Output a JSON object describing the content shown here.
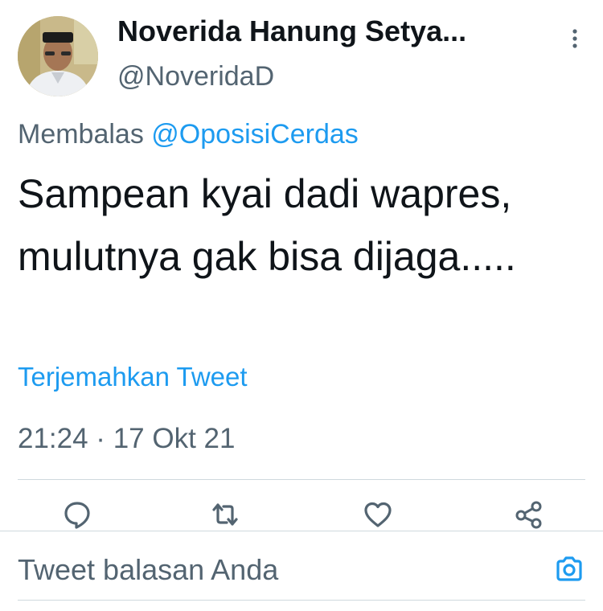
{
  "tweet": {
    "author": {
      "display_name": "Noverida Hanung Setya...",
      "handle": "@NoveridaD"
    },
    "reply_prefix": "Membalas",
    "reply_to": "@OposisiCerdas",
    "text": "Sampean kyai dadi wapres, mulutnya gak bisa dijaga.....",
    "translate_label": "Terjemahkan Tweet",
    "timestamp": "21:24 · 17 Okt 21"
  },
  "actions": {
    "reply_icon": "reply-icon",
    "retweet_icon": "retweet-icon",
    "like_icon": "like-icon",
    "share_icon": "share-icon"
  },
  "composer": {
    "placeholder": "Tweet balasan Anda",
    "camera_icon": "camera-icon"
  },
  "colors": {
    "accent": "#1d9bf0",
    "text_primary": "#0f1419",
    "text_secondary": "#536471",
    "divider": "#cfd9de"
  }
}
